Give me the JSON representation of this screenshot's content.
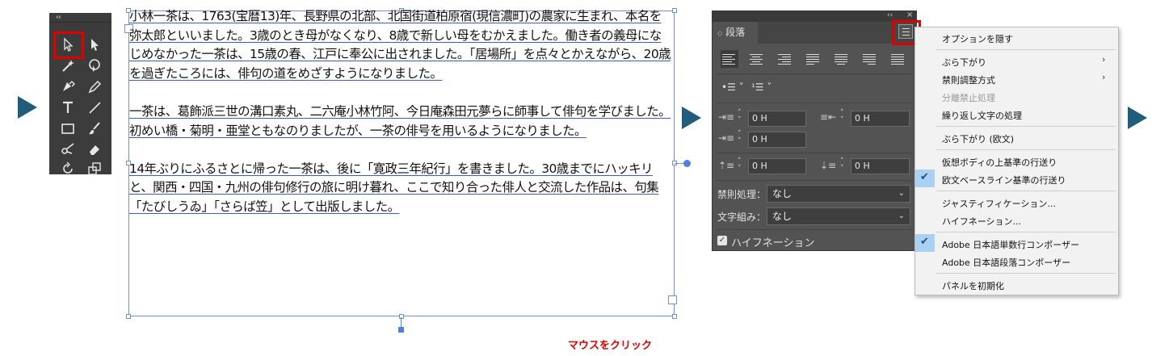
{
  "caption": "マウスをクリック",
  "text_paragraphs": [
    "小林一茶は、1763(宝暦13)年、長野県の北部、北国街道柏原宿(現信濃町)の農家に生まれ、本名を弥太郎といいました。3歳のとき母がなくなり、8歳で新しい母をむかえました。働き者の義母になじめなかった一茶は、15歳の春、江戸に奉公に出されました。「居場所」を点々とかえながら、20歳を過ぎたころには、俳句の道をめざすようになりました。",
    "一茶は、葛飾派三世の溝口素丸、二六庵小林竹阿、今日庵森田元夢らに師事して俳句を学びました。初めい橋・菊明・亜堂ともなのりましたが、一茶の俳号を用いるようになりました。",
    "14年ぶりにふるさとに帰った一茶は、後に「寛政三年紀行」を書きました。30歳までにハッキリと、関西・四国・九州の俳句修行の旅に明け暮れ、ここで知り合った俳人と交流した作品は、句集「たびしうゐ」「さらば笠」として出版しました。"
  ],
  "paragraph_panel": {
    "tab_label": "段落",
    "indent_left": "0 H",
    "indent_right": "0 H",
    "first_line_indent": "0 H",
    "space_before": "0 H",
    "space_after": "0 H",
    "kinsoku_label": "禁則処理：",
    "kinsoku_value": "なし",
    "mojikumi_label": "文字組み：",
    "mojikumi_value": "なし",
    "hyphenation_label": "ハイフネーション"
  },
  "flyout_menu": {
    "items": [
      {
        "label": "オプションを隠す"
      },
      {
        "label": "ぶら下がり",
        "submenu": true
      },
      {
        "label": "禁則調整方式",
        "submenu": true
      },
      {
        "label": "分離禁止処理",
        "disabled": true
      },
      {
        "label": "繰り返し文字の処理"
      },
      {
        "label": "ぶら下がり (欧文)"
      },
      {
        "label": "仮想ボディの上基準の行送り"
      },
      {
        "label": "欧文ベースライン基準の行送り",
        "checked": true
      },
      {
        "label": "ジャスティフィケーション..."
      },
      {
        "label": "ハイフネーション..."
      },
      {
        "label": "Adobe 日本語単数行コンポーザー",
        "checked": true
      },
      {
        "label": "Adobe 日本語段落コンポーザー"
      },
      {
        "label": "パネルを初期化"
      }
    ],
    "submenu_glyph": "›",
    "check_glyph": "✔"
  },
  "colors": {
    "accent_red": "#e00000",
    "arrow": "#1f5d7a",
    "frame_blue": "#6f8fd8",
    "panel_bg": "#535353",
    "menu_check_bg": "#aad0f2"
  }
}
